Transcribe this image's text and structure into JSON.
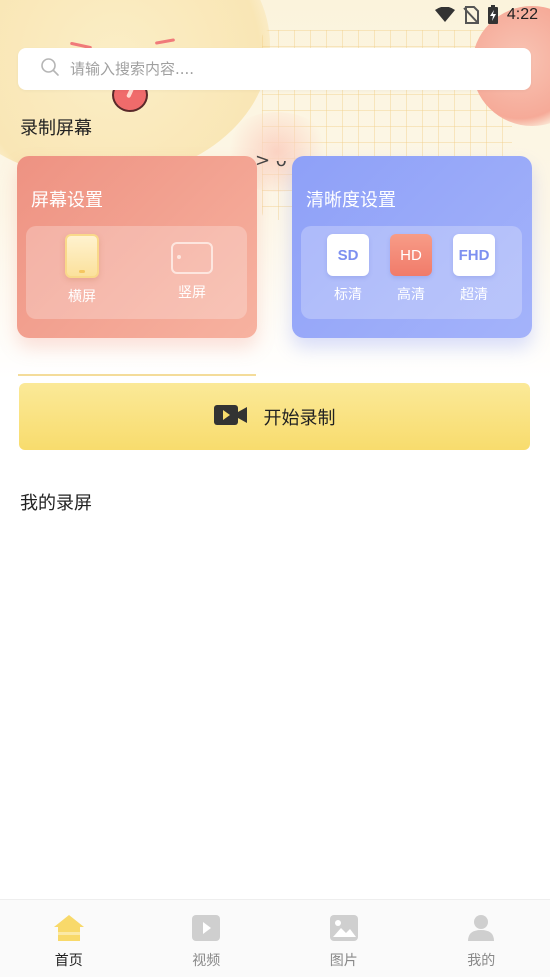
{
  "status_bar": {
    "time": "4:22"
  },
  "search": {
    "placeholder": "请输入搜索内容...."
  },
  "sections": {
    "record_title": "录制屏幕",
    "my_recordings_title": "我的录屏"
  },
  "screen_settings": {
    "title": "屏幕设置",
    "options": [
      {
        "label": "横屏",
        "icon": "portrait-phone-icon",
        "selected": true
      },
      {
        "label": "竖屏",
        "icon": "landscape-phone-icon",
        "selected": false
      }
    ]
  },
  "clarity_settings": {
    "title": "清晰度设置",
    "options": [
      {
        "badge": "SD",
        "label": "标清",
        "selected": false
      },
      {
        "badge": "HD",
        "label": "高清",
        "selected": true
      },
      {
        "badge": "FHD",
        "label": "超清",
        "selected": false
      }
    ]
  },
  "start_button": {
    "label": "开始录制",
    "icon": "video-camera-icon"
  },
  "bottom_nav": {
    "active": "home",
    "items": [
      {
        "label": "首页",
        "icon": "home-icon"
      },
      {
        "label": "视频",
        "icon": "video-icon"
      },
      {
        "label": "图片",
        "icon": "image-icon"
      },
      {
        "label": "我的",
        "icon": "user-icon"
      }
    ]
  },
  "colors": {
    "accent_yellow": "#f8dc6d",
    "screen_card": "#ee9282",
    "clarity_card": "#8ea0f8",
    "hd_active": "#f17b6a",
    "nav_active": "#f8d96a"
  }
}
